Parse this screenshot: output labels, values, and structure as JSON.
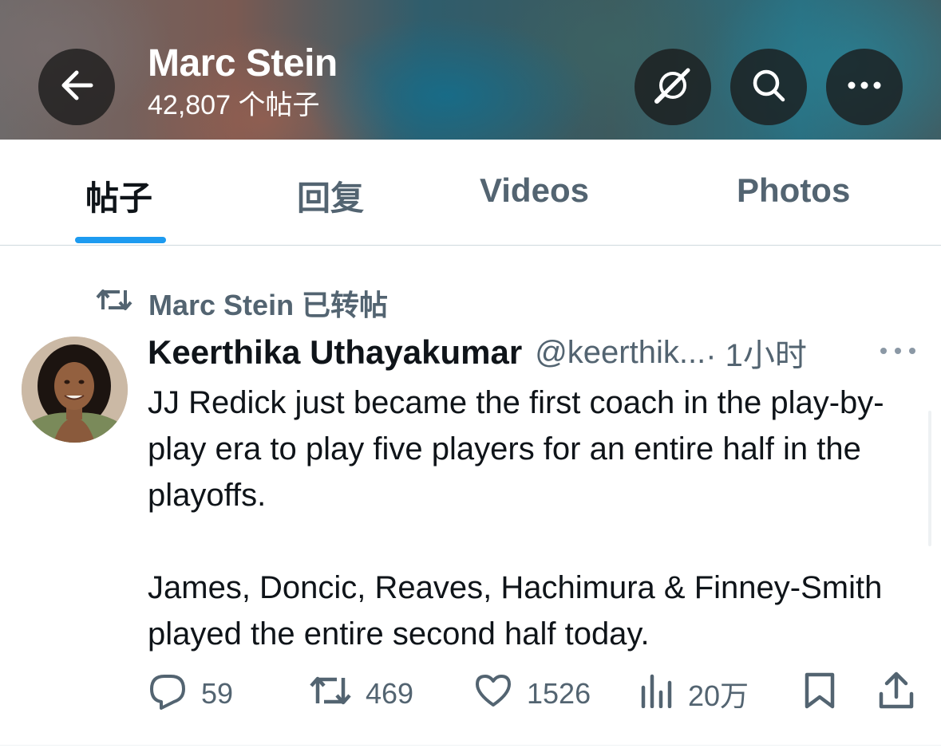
{
  "header": {
    "title": "Marc Stein",
    "post_count": "42,807 个帖子",
    "back_icon": "arrow-left-icon",
    "grok_icon": "grok-icon",
    "search_icon": "search-icon",
    "more_icon": "more-horizontal-icon"
  },
  "tabs": [
    {
      "label": "帖子",
      "active": true
    },
    {
      "label": "回复",
      "active": false
    },
    {
      "label": "Videos",
      "active": false
    },
    {
      "label": "Photos",
      "active": false
    }
  ],
  "accent_color": "#1d9bf0",
  "tweet": {
    "repost_label": "Marc Stein 已转帖",
    "author_name": "Keerthika Uthayakumar",
    "author_handle": "@keerthik...",
    "time": " · 1小时",
    "text": "JJ Redick just became the first coach in the play-by-play era to play five players for an entire half in the playoffs.\n\nJames, Doncic, Reaves, Hachimura & Finney-Smith played the entire second half today.",
    "actions": {
      "replies": "59",
      "reposts": "469",
      "likes": "1526",
      "views": "20万"
    }
  }
}
